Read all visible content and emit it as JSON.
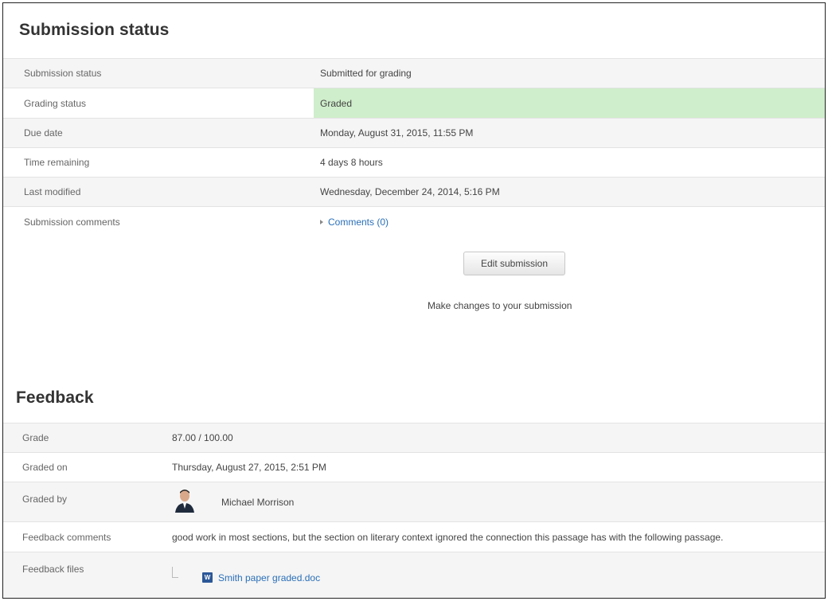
{
  "submission": {
    "heading": "Submission status",
    "rows": [
      {
        "label": "Submission status",
        "value": "Submitted for grading"
      },
      {
        "label": "Grading status",
        "value": "Graded"
      },
      {
        "label": "Due date",
        "value": "Monday, August 31, 2015, 11:55 PM"
      },
      {
        "label": "Time remaining",
        "value": "4 days 8 hours"
      },
      {
        "label": "Last modified",
        "value": "Wednesday, December 24, 2014, 5:16 PM"
      },
      {
        "label": "Submission comments",
        "value": "Comments (0)"
      }
    ],
    "edit_button": "Edit submission",
    "edit_help": "Make changes to your submission"
  },
  "feedback": {
    "heading": "Feedback",
    "rows": [
      {
        "label": "Grade",
        "value": "87.00 / 100.00"
      },
      {
        "label": "Graded on",
        "value": "Thursday, August 27, 2015, 2:51 PM"
      },
      {
        "label": "Graded by",
        "value": "Michael Morrison"
      },
      {
        "label": "Feedback comments",
        "value": "good work in most sections, but the section on literary context ignored the connection this passage has with the following passage."
      },
      {
        "label": "Feedback files",
        "value": "Smith paper graded.doc"
      }
    ]
  },
  "colors": {
    "graded_highlight": "#cfeecb",
    "link": "#2a6fb8"
  },
  "icons": {
    "comments_toggle": "triangle-right-icon",
    "avatar": "user-avatar-icon",
    "file": "word-doc-icon"
  }
}
